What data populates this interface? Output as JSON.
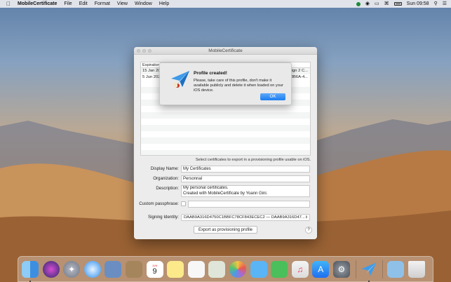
{
  "menubar": {
    "apple_icon": "apple-icon",
    "app_name": "MobileCertificate",
    "menus": [
      "File",
      "Edit",
      "Format",
      "View",
      "Window",
      "Help"
    ],
    "clock": "Sun 09:58"
  },
  "window": {
    "title": "MobileCertificate",
    "table": {
      "header_col1": "Expiration D",
      "rows": [
        {
          "date": "15 Jan 20",
          "tail": "ign 2 C..."
        },
        {
          "date": "5 Jun 202",
          "tail": "3B6A-4..."
        }
      ]
    },
    "hint": "Select certificates to export in a provisioning profile usable on iOS.",
    "form": {
      "display_name_label": "Display Name:",
      "display_name_value": "My Certificates",
      "organization_label": "Organization:",
      "organization_value": "Personnal",
      "description_label": "Description:",
      "description_line1": "My personal certificates.",
      "description_line2": "Created with MobileCertificate by Yoann Gini.",
      "passphrase_label": "Custom passphrase:",
      "signing_label": "Signing Identity:",
      "signing_value": "DAAB9A316D4750C1BBFC78CF843ECEC2 — DAAB9A316D47..."
    },
    "export_button": "Export as provisioning profile",
    "help_button": "?"
  },
  "alert": {
    "title": "Profile created!",
    "message": "Please, take care of this profile, don't make it available publicly and delete it when loaded on your iOS device.",
    "ok_button": "OK"
  },
  "dock": {
    "calendar_month": "JUN",
    "calendar_day": "9",
    "apps": [
      "finder-icon",
      "siri-icon",
      "launchpad-icon",
      "safari-icon",
      "preview-icon",
      "notes-icon",
      "calendar-icon",
      "stickies-icon",
      "reminders-icon",
      "photos-icon",
      "messages-icon",
      "facetime-icon",
      "music-icon",
      "appstore-icon",
      "system-preferences-icon",
      "mobilecertificate-icon",
      "downloads-folder-icon",
      "trash-icon"
    ]
  }
}
